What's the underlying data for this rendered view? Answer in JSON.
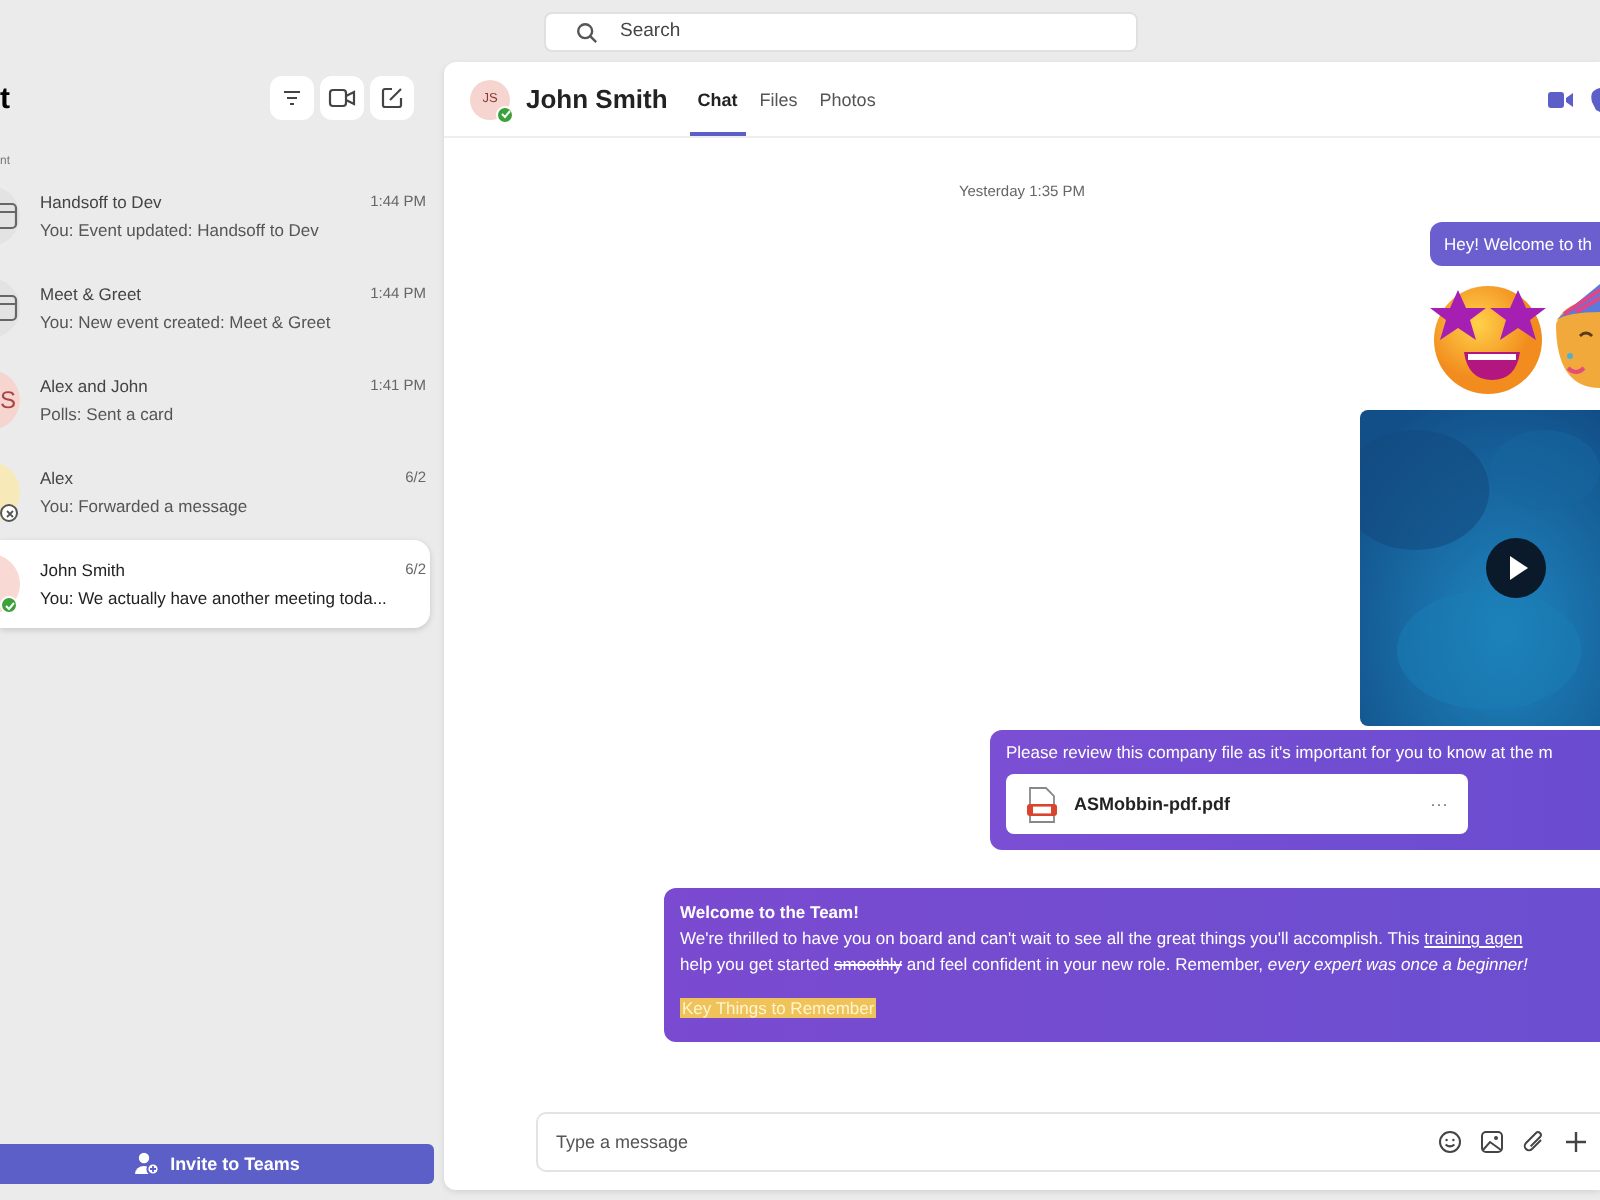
{
  "search": {
    "placeholder": "Search"
  },
  "sidebar": {
    "title": "t",
    "section_label": "nt",
    "chats": [
      {
        "kind": "calendar",
        "name": "Handsoff to Dev",
        "time": "1:44 PM",
        "preview": "You: Event updated: Handsoff to Dev",
        "selected": false
      },
      {
        "kind": "calendar",
        "name": "Meet & Greet",
        "time": "1:44 PM",
        "preview": "You: New event created: Meet & Greet",
        "selected": false
      },
      {
        "kind": "initials",
        "initials": "S",
        "color": "#f6d5d0",
        "name": "Alex and John",
        "time": "1:41 PM",
        "preview": "Polls: Sent a card",
        "selected": false
      },
      {
        "kind": "initials",
        "color": "#f8eab8",
        "badge": {
          "kind": "offline"
        },
        "name": "Alex",
        "time": "6/2",
        "preview": "You: Forwarded a message",
        "selected": false
      },
      {
        "kind": "initials",
        "color": "#f8d9d4",
        "badge": {
          "kind": "available"
        },
        "name": "John Smith",
        "time": "6/2",
        "preview": "You: We actually have another meeting toda...",
        "selected": true
      }
    ],
    "invite_button": "Invite to Teams"
  },
  "chat": {
    "contact": {
      "initials": "JS",
      "name": "John Smith",
      "badge": {
        "kind": "available"
      }
    },
    "tabs": [
      {
        "label": "Chat",
        "selected": true
      },
      {
        "label": "Files",
        "selected": false
      },
      {
        "label": "Photos",
        "selected": false
      }
    ],
    "timestamp": "Yesterday 1:35 PM",
    "messages": [
      {
        "kind": "text",
        "text": "Hey! Welcome to th"
      },
      {
        "kind": "emoji"
      },
      {
        "kind": "video"
      },
      {
        "kind": "file",
        "text": "Please review this company file as it's important for you to know at the m",
        "file_name": "ASMobbin-pdf.pdf",
        "more": "···"
      },
      {
        "kind": "rich",
        "title": "Welcome to the Team!",
        "lines": [
          [
            {
              "kind": "plain",
              "text": "We're thrilled to have you on board and can't wait to see all the great things you'll accomplish. This "
            },
            {
              "kind": "link",
              "text": "training agen"
            }
          ],
          [
            {
              "kind": "plain",
              "text": "help you get started "
            },
            {
              "kind": "strike",
              "text": "smoothly"
            },
            {
              "kind": "plain",
              "text": " and feel confident in your new role. Remember, "
            },
            {
              "kind": "italic",
              "text": "every expert was once a beginner!"
            }
          ]
        ],
        "highlight": "Key Things to Remember"
      }
    ],
    "composer": {
      "placeholder": "Type a message"
    }
  }
}
